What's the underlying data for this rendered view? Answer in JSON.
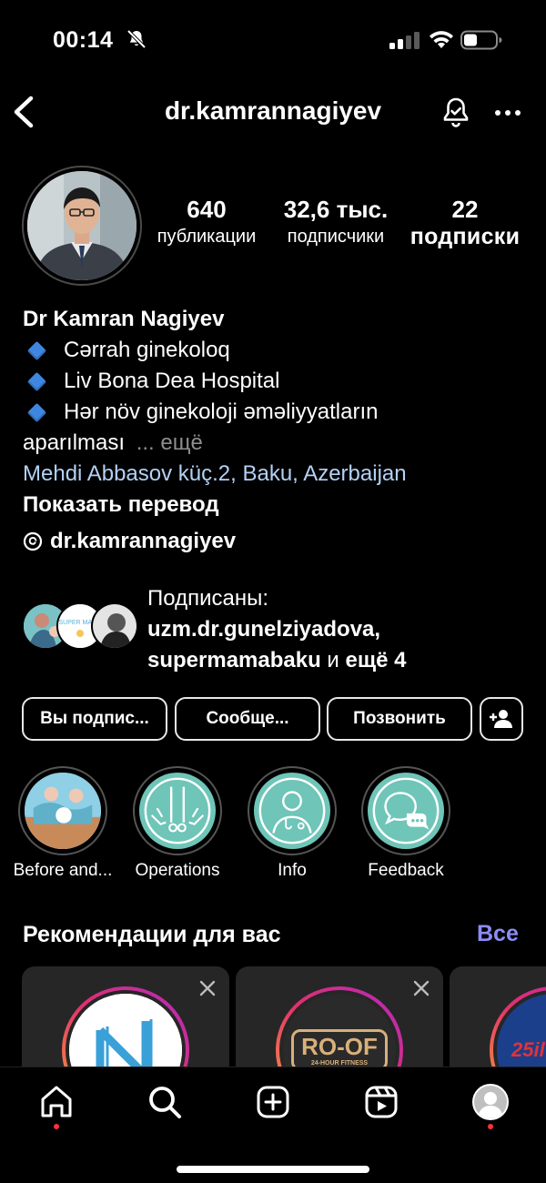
{
  "status_bar": {
    "time": "00:14"
  },
  "header": {
    "username": "dr.kamrannagiyev"
  },
  "stats": [
    {
      "value": "640",
      "label": "публикации"
    },
    {
      "value": "32,6 тыс.",
      "label": "подписчики"
    },
    {
      "value": "22",
      "label": "подписки"
    }
  ],
  "bio": {
    "name": "Dr Kamran Nagiyev",
    "lines": [
      "Cərrah ginekoloq",
      "Liv Bona Dea Hospital",
      "Hər növ ginekoloji əməliyyatların"
    ],
    "continuation": "aparılması",
    "more": "... ещё",
    "address": "Mehdi Abbasov küç.2, Baku, Azerbaijan",
    "translate": "Показать перевод",
    "threads_handle": "dr.kamrannagiyev"
  },
  "followed_by": {
    "prefix": "Подписаны:",
    "user1": "uzm.dr.gunelziyadova,",
    "user2": "supermamabaku",
    "suffix_and": "и",
    "suffix_more": "ещё 4",
    "avatar2_text": "SUPER MAMA"
  },
  "actions": {
    "following": "Вы подпис...",
    "message": "Сообще...",
    "call": "Позвонить"
  },
  "highlights": [
    {
      "label": "Before and..."
    },
    {
      "label": "Operations"
    },
    {
      "label": "Info"
    },
    {
      "label": "Feedback"
    }
  ],
  "suggestions": {
    "title": "Рекомендации для вас",
    "see_all": "Все",
    "cards": [
      {
        "logo_text": ""
      },
      {
        "logo_text": "RO-OF",
        "logo_sub": "24-HOUR FITNESS"
      },
      {
        "logo_text": "25il"
      }
    ]
  },
  "colors": {
    "background": "#000000",
    "link": "#b3d1f5",
    "accent_see_all": "#8c8cf5",
    "highlight_bg": "#6ec5b8",
    "notification_dot": "#ff3040"
  }
}
